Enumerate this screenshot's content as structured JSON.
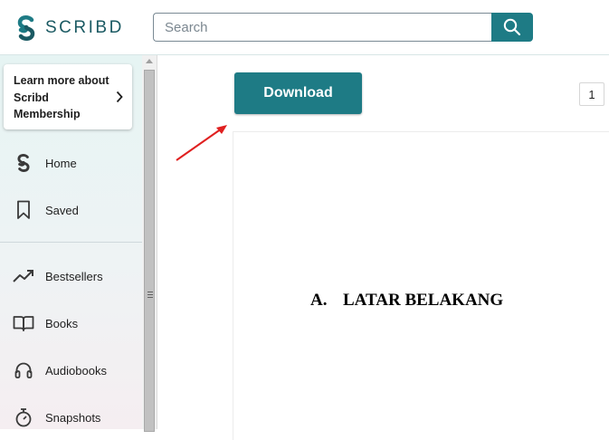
{
  "header": {
    "logo_text": "SCRIBD",
    "search": {
      "placeholder": "Search",
      "value": ""
    }
  },
  "sidebar": {
    "promo": {
      "text": "Learn more about Scribd Membership"
    },
    "items": [
      {
        "label": "Home",
        "icon": "scribd-logo-icon"
      },
      {
        "label": "Saved",
        "icon": "bookmark-icon"
      },
      {
        "label": "Bestsellers",
        "icon": "trending-up-icon"
      },
      {
        "label": "Books",
        "icon": "open-book-icon"
      },
      {
        "label": "Audiobooks",
        "icon": "headphones-icon"
      },
      {
        "label": "Snapshots",
        "icon": "stopwatch-icon"
      }
    ]
  },
  "main": {
    "download_label": "Download",
    "page_number": "1",
    "document": {
      "heading_number": "A.",
      "heading_text": "LATAR BELAKANG"
    }
  },
  "colors": {
    "accent": "#1e7b85",
    "logo": "#1b5a63",
    "annotation_arrow": "#e02020"
  }
}
